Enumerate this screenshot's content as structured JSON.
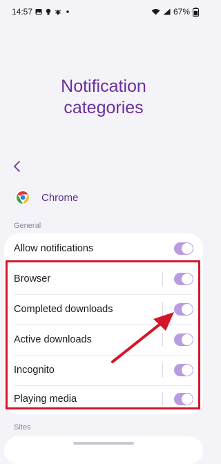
{
  "status_bar": {
    "time": "14:57",
    "left_icons": [
      "image-icon",
      "bulb-icon",
      "bug-icon",
      "dot-icon"
    ],
    "right_icons": [
      "wifi-icon",
      "signal-icon"
    ],
    "battery": "67%"
  },
  "header": {
    "title_line1": "Notification",
    "title_line2": "categories",
    "back_icon": "chevron-left-icon"
  },
  "app": {
    "name": "Chrome",
    "icon": "chrome-icon"
  },
  "sections": {
    "general_label": "General",
    "sites_label": "Sites"
  },
  "settings": [
    {
      "label": "Allow notifications",
      "enabled": true,
      "divider": false
    },
    {
      "label": "Browser",
      "enabled": true,
      "divider": true
    },
    {
      "label": "Completed downloads",
      "enabled": true,
      "divider": true
    },
    {
      "label": "Active downloads",
      "enabled": true,
      "divider": true
    },
    {
      "label": "Incognito",
      "enabled": true,
      "divider": true
    },
    {
      "label": "Playing media",
      "enabled": true,
      "divider": true
    }
  ],
  "colors": {
    "accent": "#6b2fa0",
    "toggle_on": "#b99ce0",
    "highlight": "#d3162a"
  }
}
